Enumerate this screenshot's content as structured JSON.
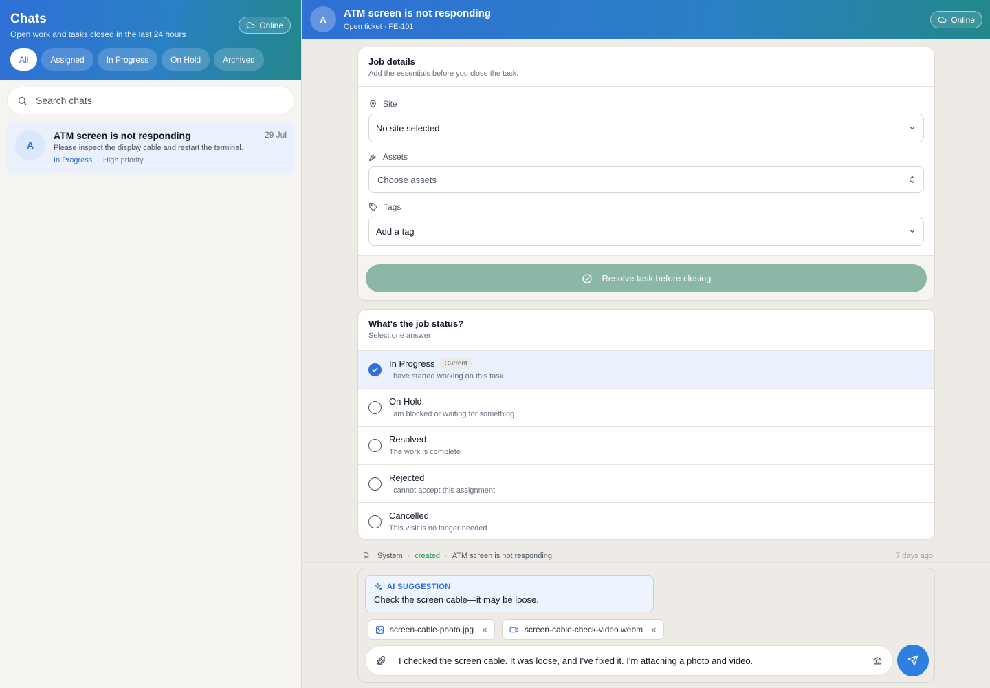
{
  "sidebar": {
    "title": "Chats",
    "subtitle": "Open work and tasks closed in the last 24 hours",
    "online_label": "Online",
    "filters": [
      {
        "label": "All",
        "active": true
      },
      {
        "label": "Assigned",
        "active": false
      },
      {
        "label": "In Progress",
        "active": false
      },
      {
        "label": "On Hold",
        "active": false
      },
      {
        "label": "Archived",
        "active": false
      }
    ],
    "search_placeholder": "Search chats",
    "chats": [
      {
        "avatar": "A",
        "title": "ATM screen is not responding",
        "date": "29 Jul",
        "preview": "Please inspect the display cable and restart the terminal.",
        "status": "In Progress",
        "separator": "·",
        "priority": "High priority"
      }
    ]
  },
  "header": {
    "avatar": "A",
    "title": "ATM screen is not responding",
    "subtitle": "Open ticket · FE-101",
    "online_label": "Online"
  },
  "job_details": {
    "title": "Job details",
    "subtitle": "Add the essentials before you close the task.",
    "site": {
      "label": "Site",
      "value": "No site selected",
      "icon": "map-pin-icon"
    },
    "assets": {
      "label": "Assets",
      "placeholder": "Choose assets",
      "icon": "wrench-icon"
    },
    "tags": {
      "label": "Tags",
      "value": "Add a tag",
      "icon": "tag-icon"
    },
    "resolve_button": "Resolve task before closing"
  },
  "job_status": {
    "title": "What's the job status?",
    "subtitle": "Select one answer",
    "options": [
      {
        "title": "In Progress",
        "subtitle": "I have started working on this task",
        "selected": true,
        "badge": "Current"
      },
      {
        "title": "On Hold",
        "subtitle": "I am blocked or waiting for something",
        "selected": false
      },
      {
        "title": "Resolved",
        "subtitle": "The work is complete",
        "selected": false
      },
      {
        "title": "Rejected",
        "subtitle": "I cannot accept this assignment",
        "selected": false
      },
      {
        "title": "Cancelled",
        "subtitle": "This visit is no longer needed",
        "selected": false
      }
    ]
  },
  "system_log": {
    "actor": "System",
    "separator": "·",
    "action": "created",
    "subject": "ATM screen is not responding",
    "time": "7 days ago"
  },
  "composer": {
    "ai_label": "AI SUGGESTION",
    "ai_text": "Check the screen cable—it may be loose.",
    "attachments": [
      {
        "name": "screen-cable-photo.jpg",
        "icon": "image-icon"
      },
      {
        "name": "screen-cable-check-video.webm",
        "icon": "video-icon"
      }
    ],
    "remove_glyph": "×",
    "message": "I checked the screen cable. It was loose, and I've fixed it. I'm attaching a photo and video."
  },
  "colors": {
    "accent": "#2f6fd6",
    "header_gradient_end": "#23878a",
    "resolve_button": "#8ab7a6",
    "created": "#16a34a",
    "selected_row": "#eaf1fd"
  }
}
